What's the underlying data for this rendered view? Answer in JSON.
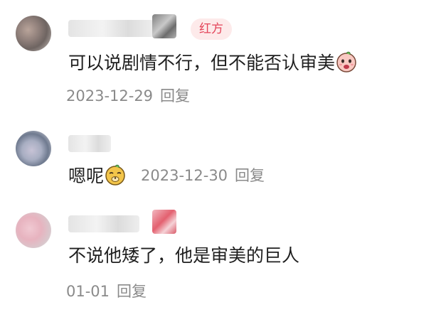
{
  "comments": [
    {
      "badge": "红方",
      "text": "可以说剧情不行，但不能否认审美",
      "emoji": "peach-face-emoji",
      "date": "2023-12-29",
      "reply": "回复"
    },
    {
      "text": "嗯呢",
      "emoji": "doge-face-emoji",
      "date": "2023-12-30",
      "reply": "回复"
    },
    {
      "text": "不说他矮了，他是审美的巨人",
      "date": "01-01",
      "reply": "回复"
    }
  ],
  "colors": {
    "badge_text": "#e4455a",
    "badge_bg": "#fdeaea",
    "meta_text": "#8a8a8a",
    "body_text": "#1f1f1f"
  }
}
